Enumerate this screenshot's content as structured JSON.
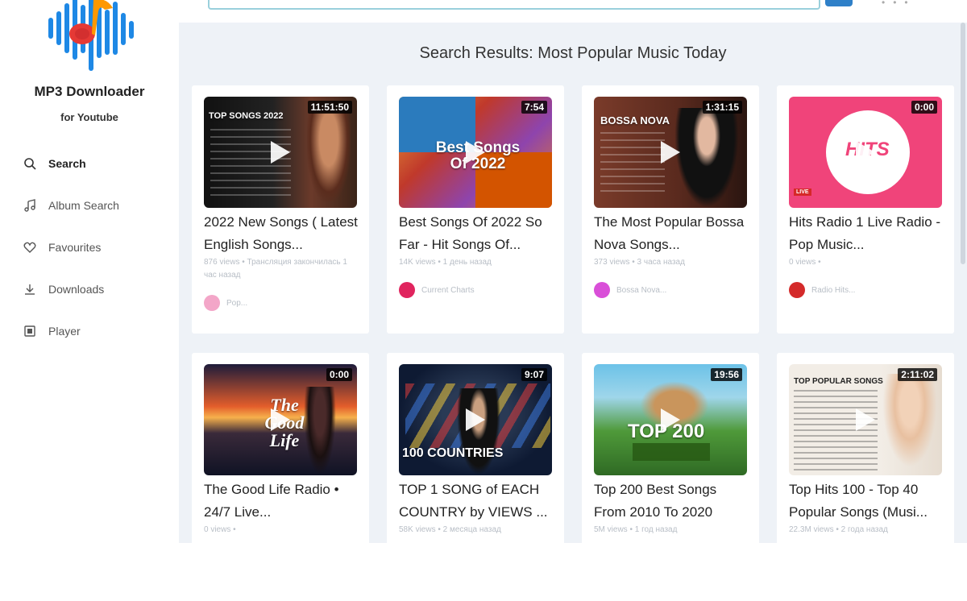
{
  "app": {
    "title": "MP3 Downloader",
    "subtitle": "for Youtube"
  },
  "nav": [
    {
      "label": "Search",
      "icon": "search-icon",
      "active": true
    },
    {
      "label": "Album Search",
      "icon": "music-note-icon"
    },
    {
      "label": "Favourites",
      "icon": "heart-icon"
    },
    {
      "label": "Downloads",
      "icon": "download-icon"
    },
    {
      "label": "Player",
      "icon": "film-icon"
    }
  ],
  "results_title": "Search Results: Most Popular Music Today",
  "videos": [
    {
      "title": "2022 New Songs ( Latest English Songs...",
      "duration": "11:51:50",
      "thumb_text": "TOP SONGS 2022",
      "views": "876 views",
      "age": "Трансляция закончилась 1 час назад",
      "channel": "Pop...",
      "avatar_color": "#f3a6c8"
    },
    {
      "title": "Best Songs Of 2022 So Far - Hit Songs Of...",
      "duration": "7:54",
      "thumb_text": "Best Songs Of 2022",
      "views": "14K views",
      "age": "1 день назад",
      "channel": "Current Charts",
      "avatar_color": "#e0245e"
    },
    {
      "title": "The Most Popular Bossa Nova Songs...",
      "duration": "1:31:15",
      "thumb_text": "BOSSA NOVA",
      "views": "373 views",
      "age": "3 часа назад",
      "channel": "Bossa Nova...",
      "avatar_color": "#d94fd8"
    },
    {
      "title": "Hits Radio 1 Live Radio - Pop Music...",
      "duration": "0:00",
      "thumb_text": "HITS",
      "views": "0 views",
      "age": "",
      "channel": "Radio Hits...",
      "avatar_color": "#d42a2a"
    },
    {
      "title": "The Good Life Radio • 24/7 Live...",
      "duration": "0:00",
      "thumb_text": "The Good Life",
      "views": "0 views",
      "age": "",
      "channel": "",
      "avatar_color": "#ffffff"
    },
    {
      "title": "TOP 1 SONG of EACH COUNTRY by VIEWS ...",
      "duration": "9:07",
      "thumb_text": "100 COUNTRIES",
      "views": "58K views",
      "age": "2 месяца назад",
      "channel": "",
      "avatar_color": "#ffffff"
    },
    {
      "title": "Top 200 Best Songs From 2010 To 2020",
      "duration": "19:56",
      "thumb_text": "TOP 200",
      "views": "5M views",
      "age": "1 год назад",
      "channel": "",
      "avatar_color": "#ffffff"
    },
    {
      "title": "Top Hits 100 - Top 40 Popular Songs (Musi...",
      "duration": "2:11:02",
      "thumb_text": "TOP POPULAR SONGS",
      "views": "22.3M views",
      "age": "2 года назад",
      "channel": "",
      "avatar_color": "#ffffff"
    }
  ]
}
